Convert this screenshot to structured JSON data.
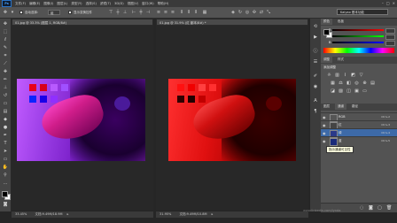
{
  "app": {
    "logo": "Ps"
  },
  "menu": [
    "文件(F)",
    "编辑(E)",
    "图像(I)",
    "图层(L)",
    "类型(Y)",
    "选择(S)",
    "滤镜(T)",
    "3D(D)",
    "视图(V)",
    "窗口(W)",
    "帮助(H)"
  ],
  "options": {
    "auto_select_label": "自动选择:",
    "auto_select_value": "组",
    "show_transform_label": "显示变换控件",
    "workspace": "Kaiyao 基本功能"
  },
  "documents": [
    {
      "tab": "01.jpg @ 33.3% (图层 1, RGB/8#)",
      "zoom": "33.45%",
      "status": "文档:9.49M/18.9M"
    },
    {
      "tab": "01.jpg @ 31.9% (红 副本/8#) *",
      "zoom": "31.95%",
      "status": "文档:9.49M/10.8M"
    }
  ],
  "color_panel": {
    "tabs": [
      "颜色",
      "色板"
    ],
    "sliders": [
      {
        "label": "R"
      },
      {
        "label": "G"
      },
      {
        "label": "B"
      }
    ]
  },
  "adjust_panel": {
    "tabs": [
      "调整",
      "样式"
    ],
    "title": "添加调整"
  },
  "layers_panel": {
    "tabs": [
      "图层",
      "通道",
      "路径"
    ],
    "channels": [
      {
        "name": "RGB",
        "shortcut": "Ctrl+2",
        "thumb": "#555555"
      },
      {
        "name": "红",
        "shortcut": "Ctrl+3",
        "thumb": "#444444"
      },
      {
        "name": "绿",
        "shortcut": "Ctrl+4",
        "thumb": "#2b3a8a"
      },
      {
        "name": "蓝",
        "shortcut": "Ctrl+5",
        "thumb": "#1a2a7a"
      }
    ]
  },
  "tooltip": "指示通道可见性",
  "watermark": "www.linkedin.com/lynda"
}
